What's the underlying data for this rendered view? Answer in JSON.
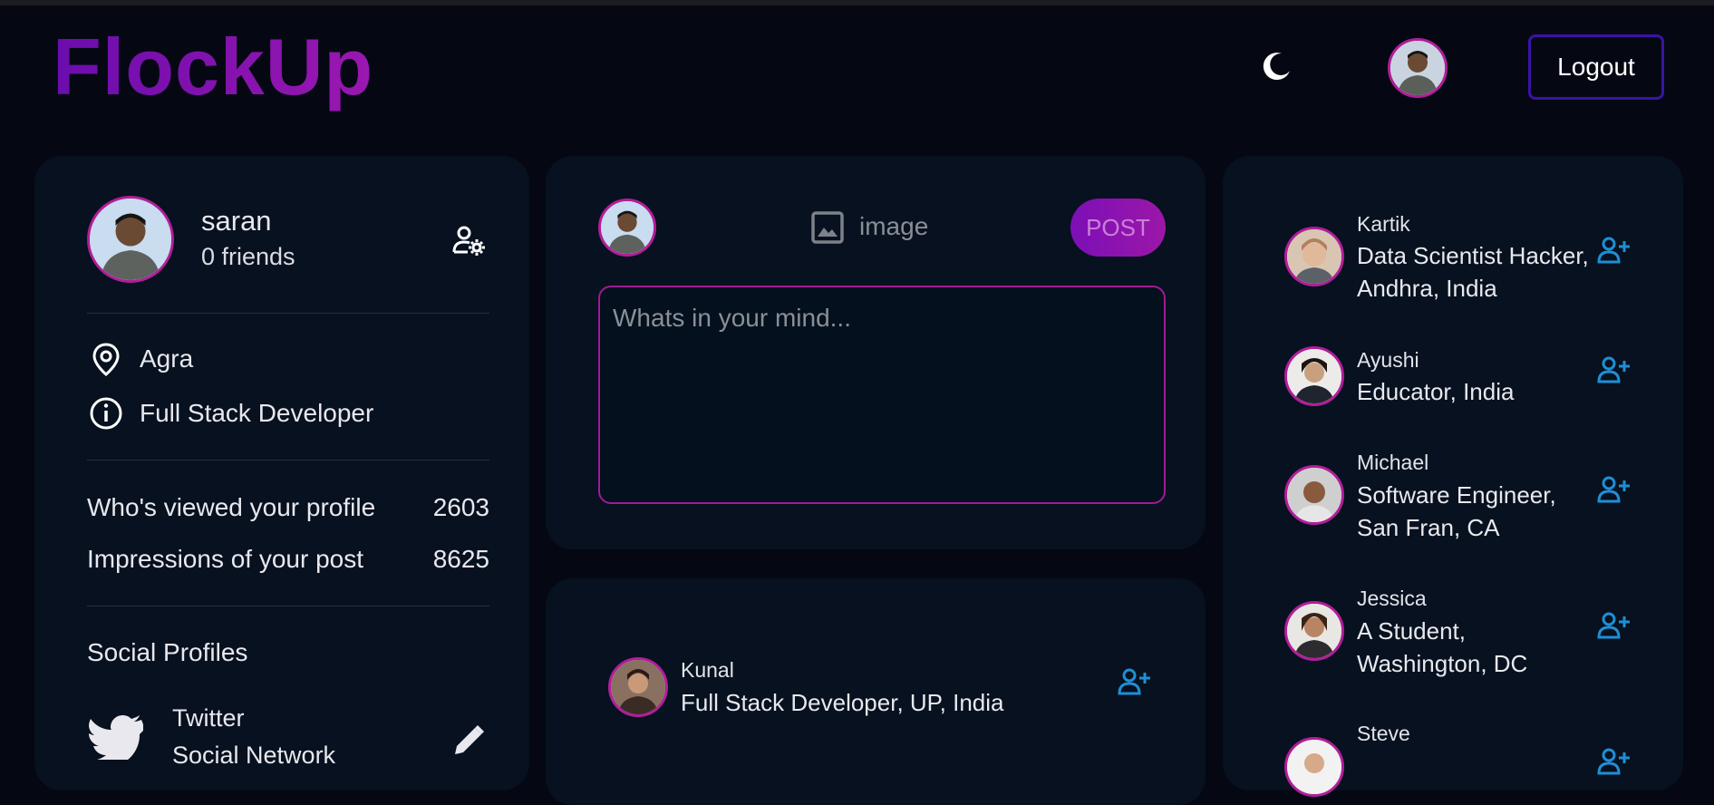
{
  "app": {
    "logo": "FlockUp",
    "logout_label": "Logout",
    "theme_icon": "moon-icon"
  },
  "profile": {
    "name": "saran",
    "friends": "0 friends",
    "location": "Agra",
    "occupation": "Full Stack Developer",
    "stats": [
      {
        "label": "Who's viewed your profile",
        "value": "2603"
      },
      {
        "label": "Impressions of your post",
        "value": "8625"
      }
    ],
    "social_heading": "Social Profiles",
    "social": [
      {
        "name": "Twitter",
        "type": "Social Network"
      }
    ]
  },
  "composer": {
    "image_label": "image",
    "post_label": "POST",
    "placeholder": "Whats in your mind..."
  },
  "feed": [
    {
      "name": "Kunal",
      "subtitle": "Full Stack Developer, UP, India"
    }
  ],
  "suggestions": [
    {
      "name": "Kartik",
      "subtitle": "Data Scientist Hacker, Andhra, India"
    },
    {
      "name": "Ayushi",
      "subtitle": "Educator, India"
    },
    {
      "name": "Michael",
      "subtitle": "Software Engineer, San Fran, CA"
    },
    {
      "name": "Jessica",
      "subtitle": "A Student, Washington, DC"
    },
    {
      "name": "Steve",
      "subtitle": ""
    }
  ],
  "colors": {
    "accent": "#9b17b0",
    "link_blue": "#1e8fd6",
    "background": "#050812",
    "card": "#07111f"
  }
}
